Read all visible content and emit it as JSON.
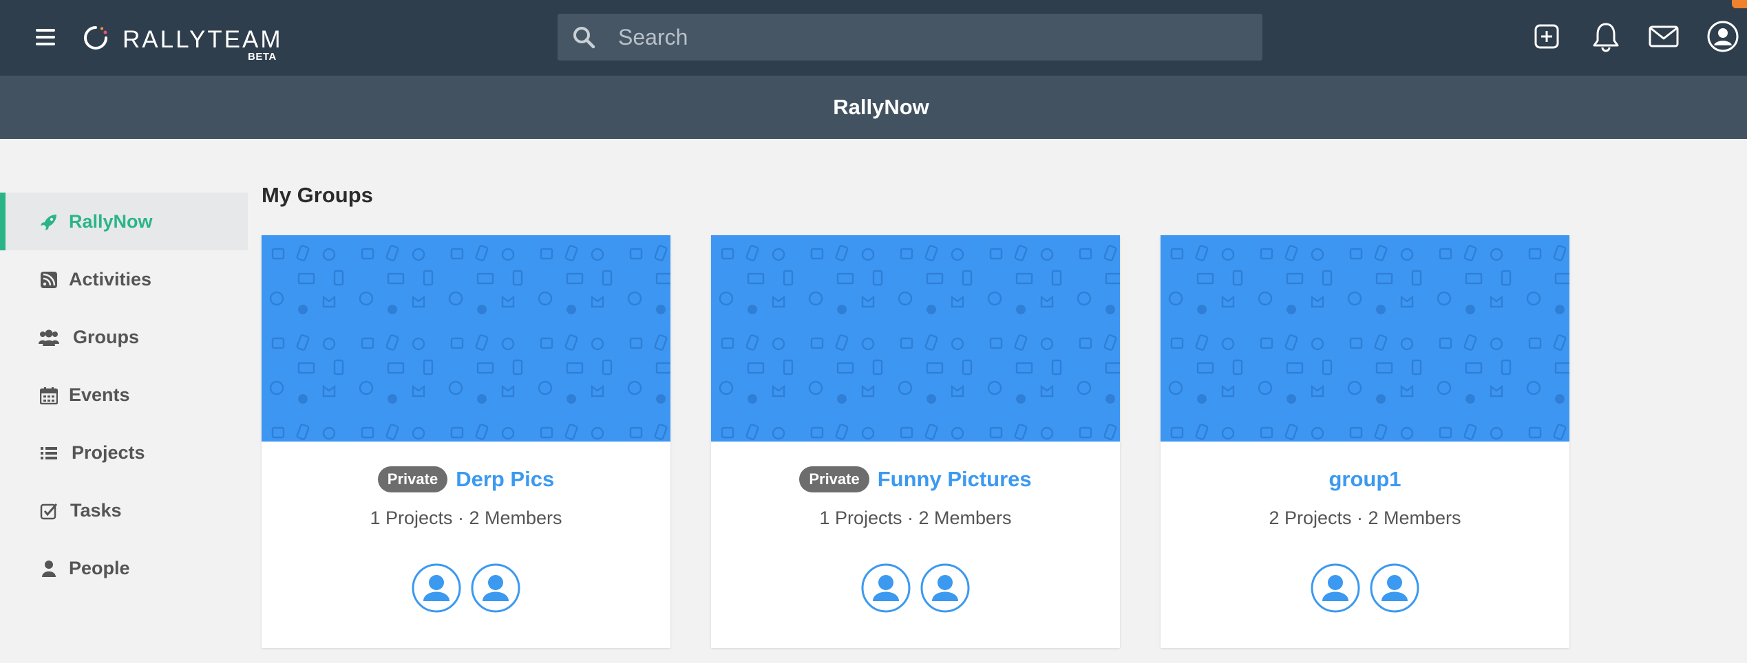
{
  "header": {
    "logo_text": "RALLYTEAM",
    "logo_badge": "BETA",
    "search_placeholder": "Search",
    "icons": [
      "menu-icon",
      "plus-square-icon",
      "bell-icon",
      "envelope-icon",
      "user-circle-icon"
    ]
  },
  "subheader": {
    "title": "RallyNow"
  },
  "sidebar": {
    "items": [
      {
        "label": "RallyNow",
        "icon": "rocket-icon",
        "active": true
      },
      {
        "label": "Activities",
        "icon": "rss-icon"
      },
      {
        "label": "Groups",
        "icon": "users-icon"
      },
      {
        "label": "Events",
        "icon": "calendar-icon"
      },
      {
        "label": "Projects",
        "icon": "list-icon"
      },
      {
        "label": "Tasks",
        "icon": "check-square-icon"
      },
      {
        "label": "People",
        "icon": "user-icon"
      }
    ]
  },
  "main": {
    "section_title": "My Groups",
    "groups": [
      {
        "privacy": "Private",
        "name": "Derp Pics",
        "stats": "1 Projects · 2 Members",
        "member_count": 2
      },
      {
        "privacy": "Private",
        "name": "Funny Pictures",
        "stats": "1 Projects · 2 Members",
        "member_count": 2
      },
      {
        "privacy": "",
        "name": "group1",
        "stats": "2 Projects · 2 Members",
        "member_count": 2
      }
    ]
  },
  "colors": {
    "topbar": "#2f3e4d",
    "subheader": "#435261",
    "accent_green": "#2bb586",
    "link_blue": "#3b99f0",
    "banner_blue": "#3d97f2",
    "notification": "#f0822d"
  }
}
